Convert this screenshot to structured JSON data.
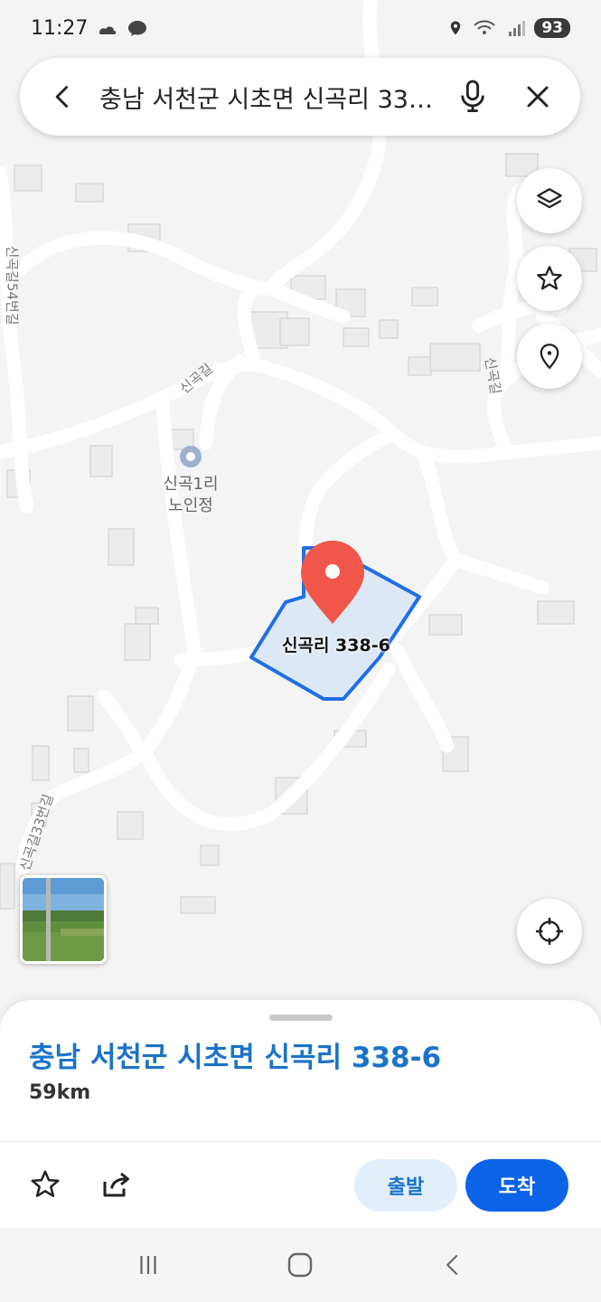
{
  "status": {
    "time": "11:27",
    "battery": "93"
  },
  "search": {
    "query": "충남 서천군 시초면 신곡리 338-6"
  },
  "map": {
    "road_labels": [
      "신곡길54번길",
      "신곡길",
      "신곡길",
      "신곡길33번길"
    ],
    "poi": {
      "line1": "신곡1리",
      "line2": "노인정"
    },
    "parcel_label": "신곡리 338-6"
  },
  "place": {
    "title": "충남 서천군 시초면 신곡리 338-6",
    "distance": "59km"
  },
  "actions": {
    "depart": "출발",
    "arrive": "도착"
  },
  "icons": {
    "layers": "layers-icon",
    "favorite": "star-icon",
    "pin": "location-pin-icon",
    "locate": "crosshair-icon"
  },
  "colors": {
    "accent": "#0b63e8",
    "title": "#1a73c9",
    "marker": "#f0574a",
    "parcel_fill": "#dde8f6",
    "parcel_stroke": "#1f6fe5"
  }
}
